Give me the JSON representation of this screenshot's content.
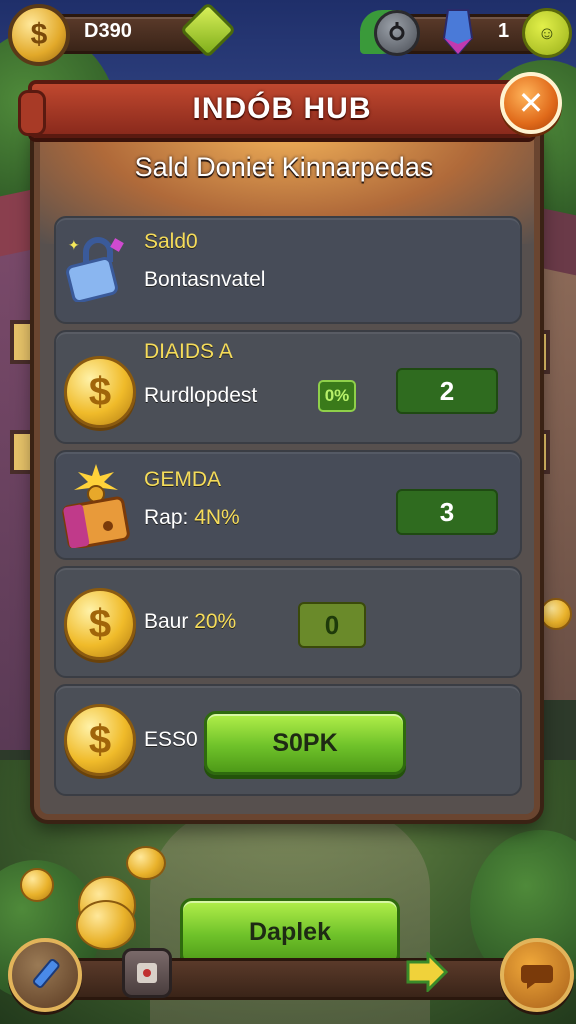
{
  "hud": {
    "coins_value": "D390",
    "gems_value": "1",
    "coin_symbol": "$"
  },
  "dialog": {
    "title": "INDÓB HUB",
    "close_symbol": "✕",
    "subtitle": "Sald  Doniet Kinnarpedas"
  },
  "rows": [
    {
      "title": "Sald0",
      "desc": "Bontasnvatel",
      "icon": "padlock-icon"
    },
    {
      "title": "DIAIDS A",
      "desc": "Rurdlopdest",
      "tag": "0%",
      "value": "2",
      "icon": "coin-icon"
    },
    {
      "title": "GEMDA",
      "desc_prefix": "Rap: ",
      "desc_highlight": "4N%",
      "value": "3",
      "icon": "treasure-chest-icon"
    },
    {
      "desc_prefix": "Baur ",
      "desc_highlight": "20%",
      "value": "0",
      "icon": "coin-icon"
    },
    {
      "desc": "ESS0",
      "button_label": "S0PK",
      "icon": "coin-icon"
    }
  ],
  "bottom": {
    "main_button": "Daplek"
  },
  "colors": {
    "accent_yellow": "#f5dc5a",
    "button_green": "#6fc22a",
    "banner_red": "#c0482f",
    "panel_gray": "#57504e"
  }
}
